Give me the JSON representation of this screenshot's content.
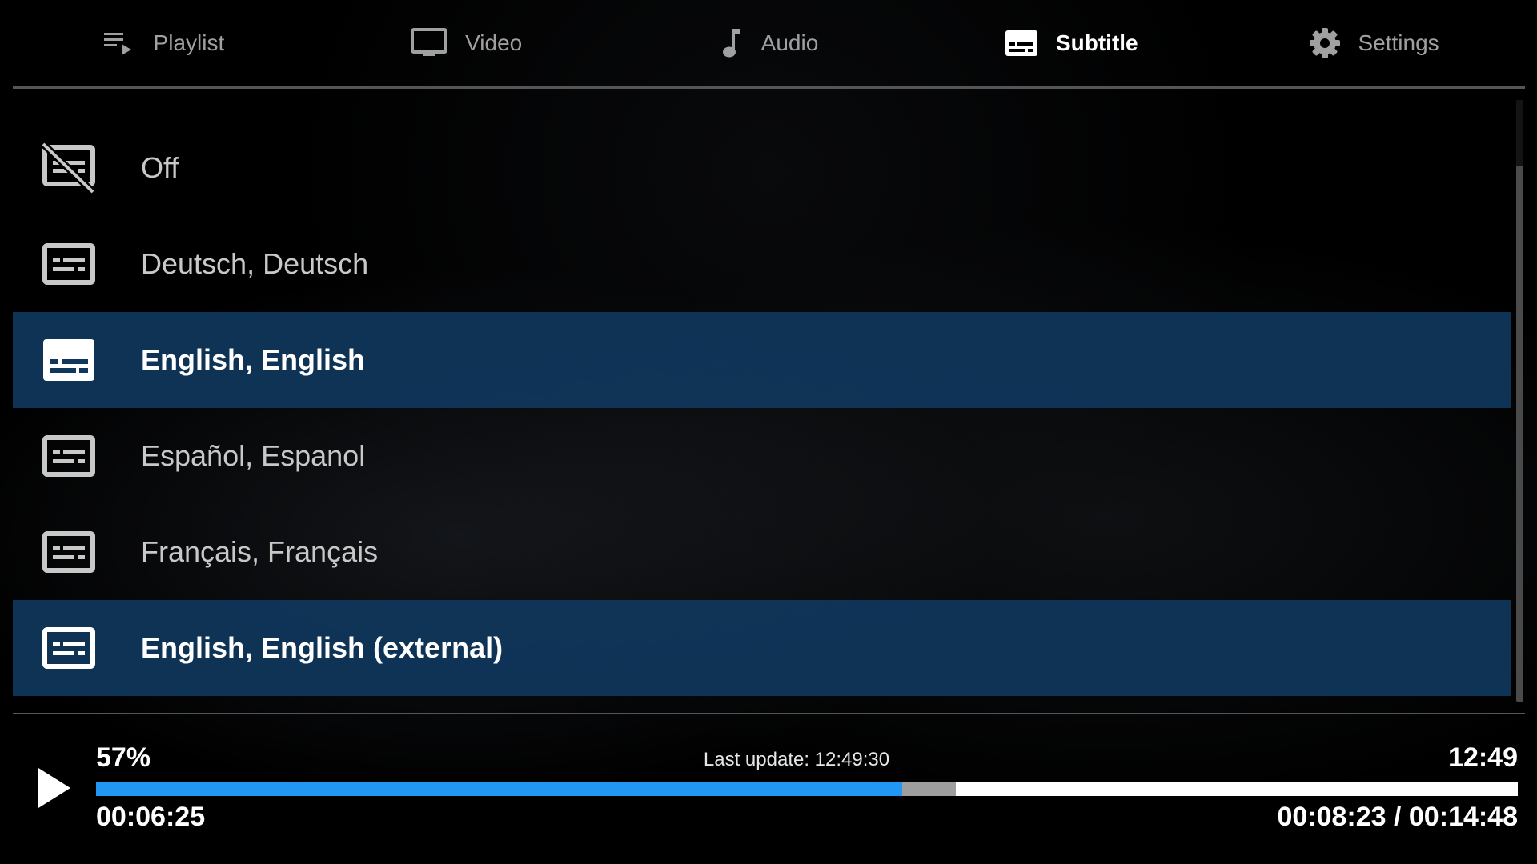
{
  "tabs": [
    {
      "label": "Playlist",
      "icon": "playlist-icon",
      "active": false
    },
    {
      "label": "Video",
      "icon": "monitor-icon",
      "active": false
    },
    {
      "label": "Audio",
      "icon": "music-note-icon",
      "active": false
    },
    {
      "label": "Subtitle",
      "icon": "subtitles-icon",
      "active": true
    },
    {
      "label": "Settings",
      "icon": "gear-icon",
      "active": false
    }
  ],
  "subtitles": [
    {
      "label": "Off",
      "icon": "subtitles-off-icon",
      "selected": false
    },
    {
      "label": "Deutsch, Deutsch",
      "icon": "subtitles-outline-icon",
      "selected": false
    },
    {
      "label": "English, English",
      "icon": "subtitles-filled-icon",
      "selected": true
    },
    {
      "label": "Español, Espanol",
      "icon": "subtitles-outline-icon",
      "selected": false
    },
    {
      "label": "Français, Français",
      "icon": "subtitles-outline-icon",
      "selected": false
    },
    {
      "label": "English, English (external)",
      "icon": "subtitles-outline-icon",
      "selected": true
    }
  ],
  "player": {
    "percent": "57%",
    "last_update": "Last update: 12:49:30",
    "clock": "12:49",
    "elapsed": "00:06:25",
    "times": "00:08:23 / 00:14:48",
    "progress_fraction": 0.567,
    "buffer_fraction": 0.605
  },
  "colors": {
    "accent": "#2196f3",
    "selected_row": "#10375c",
    "buffer": "#9e9e9e"
  }
}
